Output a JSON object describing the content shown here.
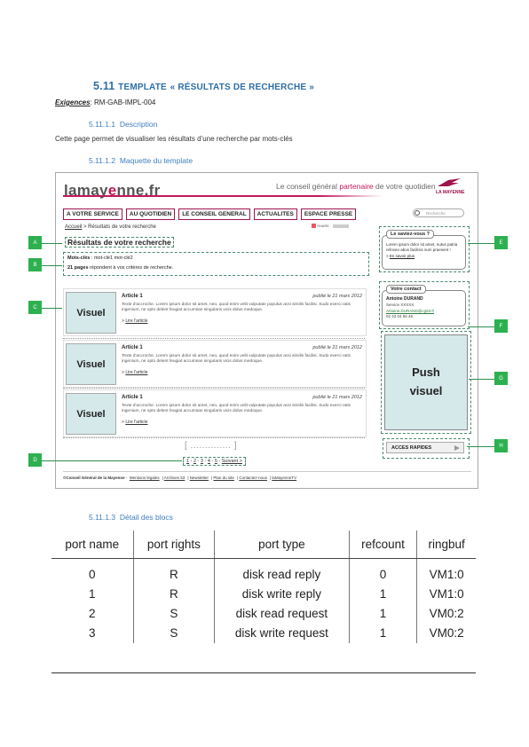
{
  "section": {
    "number": "5.11",
    "title_word1": "Template",
    "title_rest": "« Résultats de recherche »"
  },
  "requirements": {
    "label": "Exigences",
    "value": ": RM-GAB-IMPL-004"
  },
  "sub1": {
    "number": "5.11.1.1",
    "title": "Description"
  },
  "description": "Cette page permet de visualiser les résultats d’une recherche par mots-clés",
  "sub2": {
    "number": "5.11.1.2",
    "title": "Maquette du template"
  },
  "mockup": {
    "logo_prefix": "lamay",
    "logo_e": "e",
    "logo_suffix": "nne.fr",
    "slogan_a": "Le conseil général ",
    "slogan_b": "partenaire",
    "slogan_c": " de votre quotidien",
    "brand": "LA MAYENNE",
    "nav": [
      "A VOTRE SERVICE",
      "AU QUOTIDIEN",
      "LE CONSEIL GENERAL",
      "ACTUALITES",
      "ESPACE PRESSE"
    ],
    "search_placeholder": "Recherche",
    "breadcrumb_home": "Accueil",
    "breadcrumb_rest": " > Résultats de votre recherche",
    "share": "SHARE",
    "results_title": "Résultats de votre recherche",
    "keywords_label": "Mots-clés",
    "keywords_value": " : mot-clé1 mot-clé2",
    "count_bold": "21 pages",
    "count_rest": " répondent à vos critères de recherche.",
    "articles": [
      {
        "visual": "Visuel",
        "title": "Article 1",
        "date": "publié le 21 mars 2012",
        "text": "Texte d'accroche. Lorem ipsum dolor sit amet, neo, quod enim velit vulputate populus acsi similis facilisi. Sudo exerci ratis ingenium, ne opto delent feugiat accumsan singularis vicis dolus medoque.",
        "link": "Lire l'article"
      },
      {
        "visual": "Visuel",
        "title": "Article 1",
        "date": "publié le 21 mars 2012",
        "text": "Texte d'accroche. Lorem ipsum dolor sit amet, neo, quod enim velit vulputate populus acsi similis facilisi. Sudo exerci ratis ingenium, ne opto delent feugiat accumsan singularis vicis dolus medoque.",
        "link": "Lire l'article"
      },
      {
        "visual": "Visuel",
        "title": "Article 1",
        "date": "publié le 21 mars 2012",
        "text": "Texte d'accroche. Lorem ipsum dolor sit amet, neo, quod enim velit vulputate populus acsi similis facilisi. Sudo exerci ratis ingenium, ne opto delent feugiat accumsan singularis vicis dolus medoque.",
        "link": "Lire l'article"
      }
    ],
    "pager_bracket": "[ .............. ]",
    "pager": [
      "1",
      "2",
      "3",
      "4",
      "5",
      "Suivant >"
    ],
    "footer_copy": "©Conseil Général de la Mayenne",
    "footer_links": [
      "Mentions légales",
      "Archives 53",
      "Newsletter",
      "Plan du site",
      "Contactez-nous",
      "laMayenneTV"
    ],
    "side_know_title": "Le saviez-vous ?",
    "side_know_text": "Lorem ipsum dolor sit amet, nutus patria refoveo abos facilisis sum praesent !",
    "side_know_link": "En savoir plus",
    "contact_title": "Votre contact",
    "contact_name": "Antoine DURAND",
    "contact_service": "Service XXXXX",
    "contact_email": "Antoine.DURAND@cg53.fr",
    "contact_phone": "02 43 04 56 45",
    "push": "Push visuel",
    "acces": "ACCES RAPIDES",
    "markers": [
      "A",
      "B",
      "C",
      "D",
      "E",
      "F",
      "G",
      "H"
    ]
  },
  "sub3": {
    "number": "5.11.1.3",
    "title": "Détail des blocs"
  },
  "table": {
    "headers": [
      "port name",
      "port rights",
      "port type",
      "refcount",
      "ringbuf"
    ],
    "rows": [
      [
        "0",
        "R",
        "disk read reply",
        "0",
        "VM1:0"
      ],
      [
        "1",
        "R",
        "disk write reply",
        "1",
        "VM1:0"
      ],
      [
        "2",
        "S",
        "disk read request",
        "1",
        "VM0:2"
      ],
      [
        "3",
        "S",
        "disk write request",
        "1",
        "VM0:2"
      ]
    ]
  }
}
